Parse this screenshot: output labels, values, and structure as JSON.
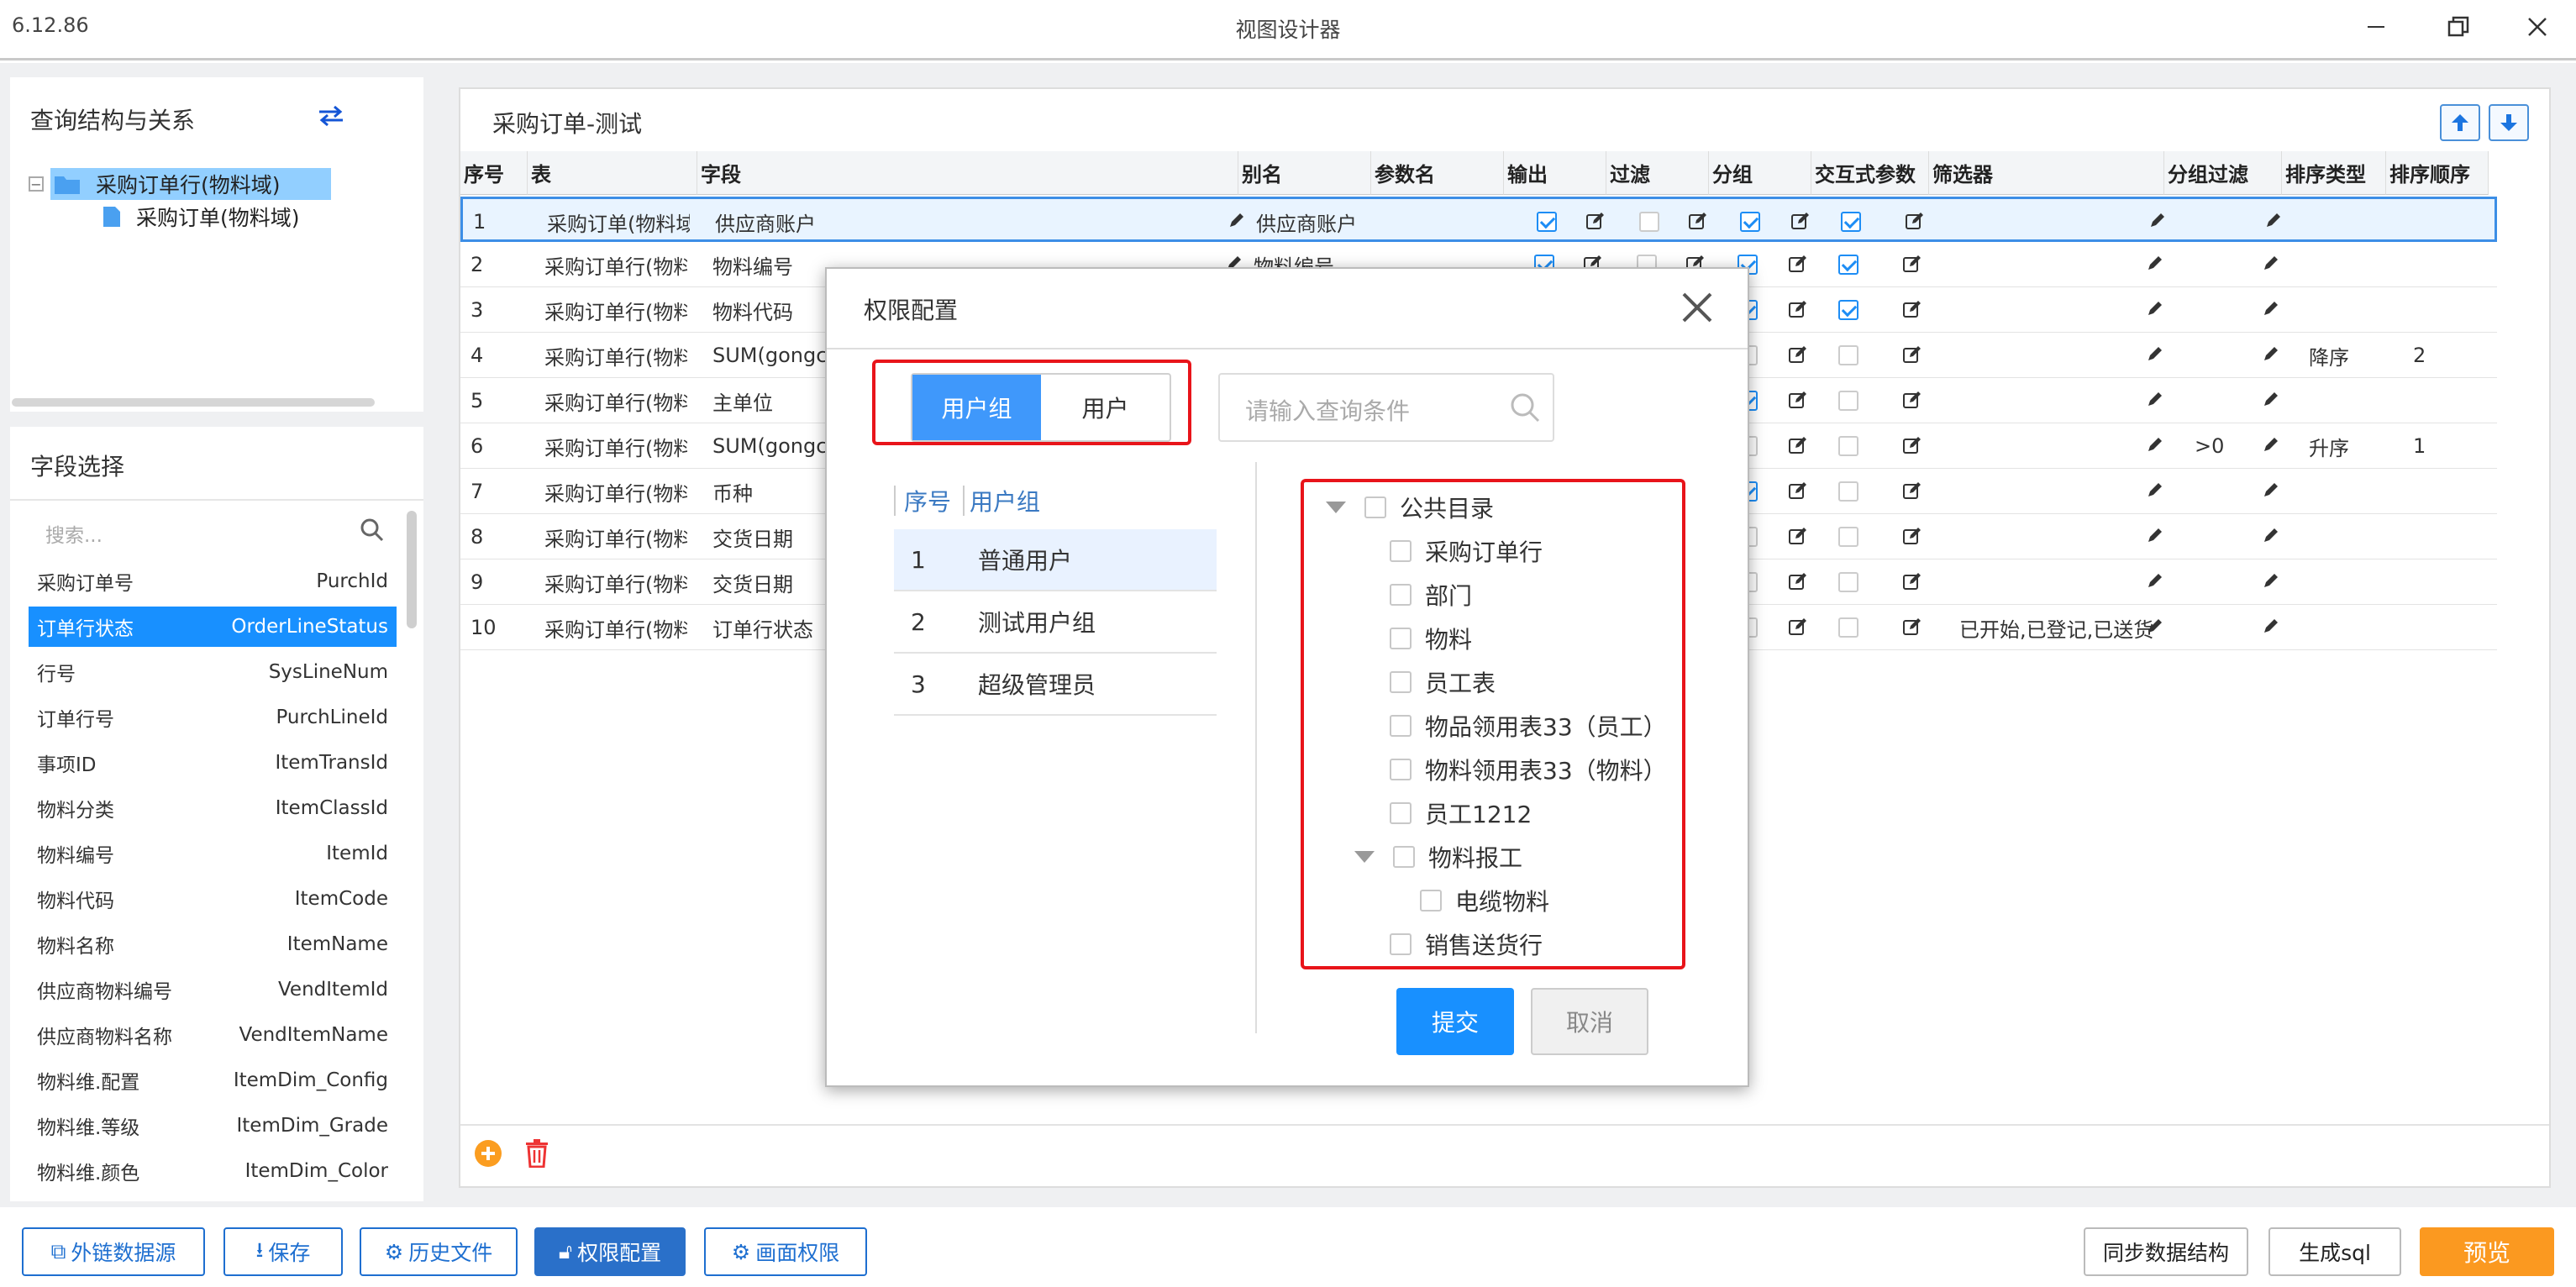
{
  "window": {
    "version": "6.12.86",
    "title": "视图设计器"
  },
  "left_top": {
    "title": "查询结构与关系",
    "tree": [
      {
        "label": "采购订单行(物料域)",
        "selected": true
      },
      {
        "label": "采购订单(物料域)"
      }
    ]
  },
  "left_fields": {
    "title": "字段选择",
    "search_placeholder": "搜索...",
    "items": [
      {
        "cn": "采购订单号",
        "en": "PurchId"
      },
      {
        "cn": "订单行状态",
        "en": "OrderLineStatus",
        "selected": true
      },
      {
        "cn": "行号",
        "en": "SysLineNum"
      },
      {
        "cn": "订单行号",
        "en": "PurchLineId"
      },
      {
        "cn": "事项ID",
        "en": "ItemTransId"
      },
      {
        "cn": "物料分类",
        "en": "ItemClassId"
      },
      {
        "cn": "物料编号",
        "en": "ItemId"
      },
      {
        "cn": "物料代码",
        "en": "ItemCode"
      },
      {
        "cn": "物料名称",
        "en": "ItemName"
      },
      {
        "cn": "供应商物料编号",
        "en": "VendItemId"
      },
      {
        "cn": "供应商物料名称",
        "en": "VendItemName"
      },
      {
        "cn": "物料维.配置",
        "en": "ItemDim_Config"
      },
      {
        "cn": "物料维.等级",
        "en": "ItemDim_Grade"
      },
      {
        "cn": "物料维.颜色",
        "en": "ItemDim_Color"
      }
    ]
  },
  "main": {
    "title": "采购订单-测试",
    "columns": [
      "序号",
      "表",
      "字段",
      "别名",
      "参数名",
      "输出",
      "过滤",
      "分组",
      "交互式参数",
      "筛选器",
      "分组过滤",
      "排序类型",
      "排序顺序"
    ],
    "rows": [
      {
        "no": "1",
        "table": "采购订单(物料域)",
        "field": "供应商账户",
        "alias": "供应商账户",
        "out": true,
        "filt": false,
        "grp": true,
        "inter": true,
        "filter_text": "",
        "gf": "",
        "sort": "",
        "order": ""
      },
      {
        "no": "2",
        "table": "采购订单行(物料域)",
        "field": "物料编号",
        "alias": "物料编号",
        "out": true,
        "filt": false,
        "grp": true,
        "inter": true,
        "filter_text": "",
        "gf": "",
        "sort": "",
        "order": ""
      },
      {
        "no": "3",
        "table": "采购订单行(物料域)",
        "field": "物料代码",
        "alias": "",
        "out": false,
        "filt": false,
        "grp": true,
        "inter": true,
        "filter_text": "",
        "gf": "",
        "sort": "",
        "order": ""
      },
      {
        "no": "4",
        "table": "采购订单行(物料域)",
        "field": "SUM(gongcheng)",
        "alias": "",
        "out": false,
        "filt": false,
        "grp": false,
        "inter": false,
        "filter_text": "",
        "gf": "",
        "sort": "降序",
        "order": "2"
      },
      {
        "no": "5",
        "table": "采购订单行(物料域)",
        "field": "主单位",
        "alias": "",
        "out": false,
        "filt": false,
        "grp": true,
        "inter": false,
        "filter_text": "",
        "gf": "",
        "sort": "",
        "order": ""
      },
      {
        "no": "6",
        "table": "采购订单行(物料域)",
        "field": "SUM(gongcheng)",
        "alias": "",
        "out": false,
        "filt": false,
        "grp": false,
        "inter": false,
        "filter_text": "",
        "gf": ">0",
        "sort": "升序",
        "order": "1"
      },
      {
        "no": "7",
        "table": "采购订单行(物料域)",
        "field": "币种",
        "alias": "",
        "out": false,
        "filt": false,
        "grp": true,
        "inter": false,
        "filter_text": "",
        "gf": "",
        "sort": "",
        "order": ""
      },
      {
        "no": "8",
        "table": "采购订单行(物料域)",
        "field": "交货日期",
        "alias": "",
        "out": false,
        "filt": false,
        "grp": false,
        "inter": false,
        "filter_text": "",
        "gf": "",
        "sort": "",
        "order": ""
      },
      {
        "no": "9",
        "table": "采购订单行(物料域)",
        "field": "交货日期",
        "alias": "",
        "out": false,
        "filt": false,
        "grp": false,
        "inter": false,
        "filter_text": "",
        "gf": "",
        "sort": "",
        "order": ""
      },
      {
        "no": "10",
        "table": "采购订单行(物料域)",
        "field": "订单行状态",
        "alias": "",
        "out": false,
        "filt": false,
        "grp": false,
        "inter": false,
        "filter_text": "已开始,已登记,已送货",
        "gf": "",
        "sort": "",
        "order": ""
      }
    ]
  },
  "dialog": {
    "title": "权限配置",
    "tab_group": "用户组",
    "tab_user": "用户",
    "search_placeholder": "请输入查询条件",
    "list_headers": {
      "no": "序号",
      "name": "用户组"
    },
    "groups": [
      {
        "no": "1",
        "name": "普通用户",
        "selected": true
      },
      {
        "no": "2",
        "name": "测试用户组"
      },
      {
        "no": "3",
        "name": "超级管理员"
      }
    ],
    "tree": {
      "root": "公共目录",
      "children": [
        "采购订单行",
        "部门",
        "物料",
        "员工表",
        "物品领用表33（员工）",
        "物料领用表33（物料）",
        "员工1212"
      ],
      "sub_parent": "物料报工",
      "sub_children": [
        "电缆物料"
      ],
      "last": "销售送货行"
    },
    "submit": "提交",
    "cancel": "取消"
  },
  "bottom": {
    "ext_source": "外链数据源",
    "save": "保存",
    "history": "历史文件",
    "perm": "权限配置",
    "screen_perm": "画面权限",
    "sync": "同步数据结构",
    "gen_sql": "生成sql",
    "preview": "预览"
  },
  "colors": {
    "accent": "#1890ff",
    "danger_box": "#e8141a",
    "preview": "#fb9920"
  }
}
